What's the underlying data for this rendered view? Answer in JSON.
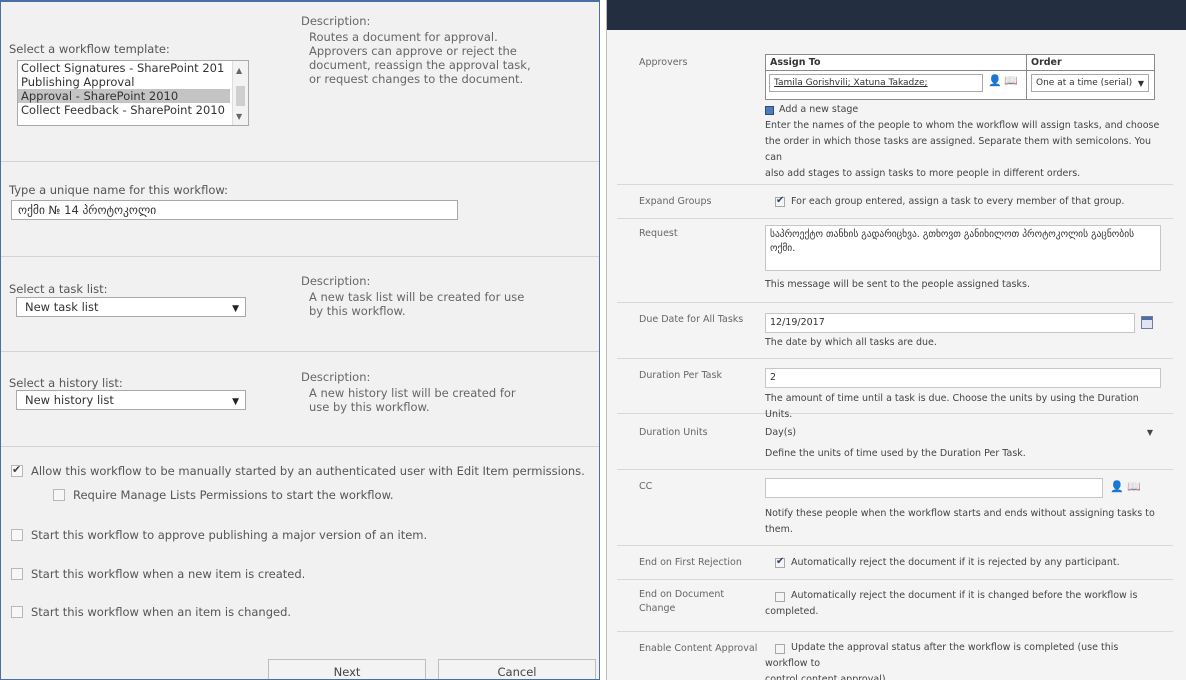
{
  "left": {
    "template_label": "Select a workflow template:",
    "templates": [
      "Collect Signatures - SharePoint 201",
      "Publishing Approval",
      "Approval - SharePoint 2010",
      "Collect Feedback - SharePoint 2010"
    ],
    "selected_template_index": 2,
    "template_desc_title": "Description:",
    "template_desc_lines": [
      "Routes a document for approval.",
      "Approvers can approve or reject the",
      "document, reassign the approval task,",
      "or request changes to the document."
    ],
    "name_label": "Type a unique name for this workflow:",
    "name_value": "ოქმი № 14 პროტოკოლი",
    "task_list_label": "Select a task list:",
    "task_list_value": "New task list",
    "task_desc_title": "Description:",
    "task_desc_lines": [
      "A new task list will be created for use",
      "by this workflow."
    ],
    "history_list_label": "Select a history list:",
    "history_list_value": "New history list",
    "history_desc_title": "Description:",
    "history_desc_lines": [
      "A new history list will be created for",
      "use by this workflow."
    ],
    "options": {
      "manual_start": {
        "label": "Allow this workflow to be manually started by an authenticated user with Edit Item permissions.",
        "checked": true
      },
      "require_manage": {
        "label": "Require Manage Lists Permissions to start the workflow.",
        "checked": false
      },
      "approve_publish": {
        "label": "Start this workflow to approve publishing a major version of an item.",
        "checked": false
      },
      "on_create": {
        "label": "Start this workflow when a new item is created.",
        "checked": false
      },
      "on_change": {
        "label": "Start this workflow when an item is changed.",
        "checked": false
      }
    },
    "next_label": "Next",
    "cancel_label": "Cancel"
  },
  "right": {
    "approvers_label": "Approvers",
    "assign_to_header": "Assign To",
    "order_header": "Order",
    "assignees": "Tamila Gorishvili; Xatuna Takadze;",
    "order_value": "One at a time (serial)",
    "add_stage": "Add a new stage",
    "approvers_help": [
      "Enter the names of the people to whom the workflow will assign tasks, and choose",
      "the order in which those tasks are assigned. Separate them with semicolons. You can",
      "also add stages to assign tasks to more people in different orders."
    ],
    "expand_groups_label": "Expand Groups",
    "expand_groups_text": "For each group entered, assign a task to every member of that group.",
    "request_label": "Request",
    "request_value": "საპროექტო თანხის გადარიცხვა. გთხოვთ განიხილოთ პროტოკოლის გაცნობის ოქმი.",
    "request_help": "This message will be sent to the people assigned tasks.",
    "due_date_label": "Due Date for All Tasks",
    "due_date_value": "12/19/2017",
    "due_date_help": "The date by which all tasks are due.",
    "duration_label": "Duration Per Task",
    "duration_value": "2",
    "duration_help": "The amount of time until a task is due. Choose the units by using the Duration Units.",
    "units_label": "Duration Units",
    "units_value": "Day(s)",
    "units_help": "Define the units of time used by the Duration Per Task.",
    "cc_label": "CC",
    "cc_value": "",
    "cc_help": [
      "Notify these people when the workflow starts and ends without assigning tasks to",
      "them."
    ],
    "end_reject_label": "End on First Rejection",
    "end_reject_text": "Automatically reject the document if it is rejected by any participant.",
    "end_change_label": [
      "End on Document",
      "Change"
    ],
    "end_change_text": [
      "Automatically reject the document if it is changed before the workflow is",
      "completed."
    ],
    "content_approval_label": "Enable Content Approval",
    "content_approval_text": [
      "Update the approval status after the workflow is completed (use this workflow to",
      "control content approval)."
    ]
  }
}
